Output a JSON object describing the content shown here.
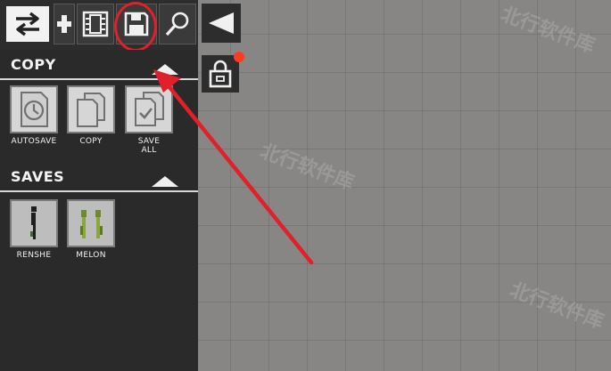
{
  "toolbar": {
    "swap_icon": "swap-arrows-icon",
    "pin_icon": "pin-icon",
    "film_icon": "film-icon",
    "save_icon": "floppy-disk-icon",
    "search_icon": "magnifier-icon"
  },
  "copy_section": {
    "title": "COPY",
    "items": [
      {
        "label": "AUTOSAVE",
        "icon": "autosave-clock-icon"
      },
      {
        "label": "COPY",
        "icon": "copy-pages-icon"
      },
      {
        "label_line1": "SAVE",
        "label_line2": "ALL",
        "icon": "save-all-check-icon"
      }
    ]
  },
  "saves_section": {
    "title": "SAVES",
    "items": [
      {
        "label": "RENSHE",
        "icon": "ragdoll-human-thumbnail"
      },
      {
        "label": "MELON",
        "icon": "melon-people-thumbnail"
      }
    ]
  },
  "right_controls": {
    "play_icon": "triangle-left-icon",
    "lock_icon": "lock-icon"
  },
  "watermark": "北行软件库",
  "colors": {
    "highlight": "#e0202a",
    "notification": "#ff3b1f",
    "panel": "#2a2a2a",
    "canvas": "#888685"
  }
}
